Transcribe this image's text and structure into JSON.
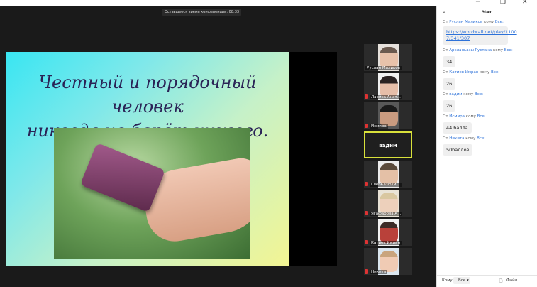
{
  "window": {
    "min": "─",
    "max": "❐",
    "close": "✕"
  },
  "meeting": {
    "remaining_label": "Оставшееся время конференции: 08:33"
  },
  "slide": {
    "line1": "Честный и порядочный человек",
    "line2": "никогда не берёт чужого."
  },
  "participants": [
    {
      "name": "Руслан Маликов",
      "muted": false
    },
    {
      "name": "Лариса Анат...",
      "muted": true
    },
    {
      "name": "Исмира",
      "muted": true
    },
    {
      "name": "вадим",
      "active": true
    },
    {
      "name": "ГлебКазюки...",
      "muted": true
    },
    {
      "name": "Ягафарова А...",
      "muted": true
    },
    {
      "name": "Катиев Имран",
      "muted": true
    },
    {
      "name": "Никита",
      "muted": true
    }
  ],
  "chat": {
    "title": "Чат",
    "messages": [
      {
        "from_prefix": "От",
        "from": "Руслан Маликов",
        "to_prefix": "кому",
        "to": "Все:",
        "text": "https://wordwall.net/play/1100 7/341/307",
        "is_link": true
      },
      {
        "from_prefix": "От",
        "from": "Арсланьазы Руслана",
        "to_prefix": "кому",
        "to": "Все:",
        "text": "34"
      },
      {
        "from_prefix": "От",
        "from": "Катиев Имран",
        "to_prefix": "кому",
        "to": "Все:",
        "text": "26"
      },
      {
        "from_prefix": "От",
        "from": "вадим",
        "to_prefix": "кому",
        "to": "Все:",
        "text": "26"
      },
      {
        "from_prefix": "От",
        "from": "Исмира",
        "to_prefix": "кому",
        "to": "Все:",
        "text": "44 балла"
      },
      {
        "from_prefix": "От",
        "from": "Никита",
        "to_prefix": "кому",
        "to": "Все:",
        "text": "50баллов"
      }
    ],
    "footer": {
      "to_label": "Кому:",
      "to_value": "Все",
      "file_label": "Файл",
      "more": "..."
    }
  }
}
